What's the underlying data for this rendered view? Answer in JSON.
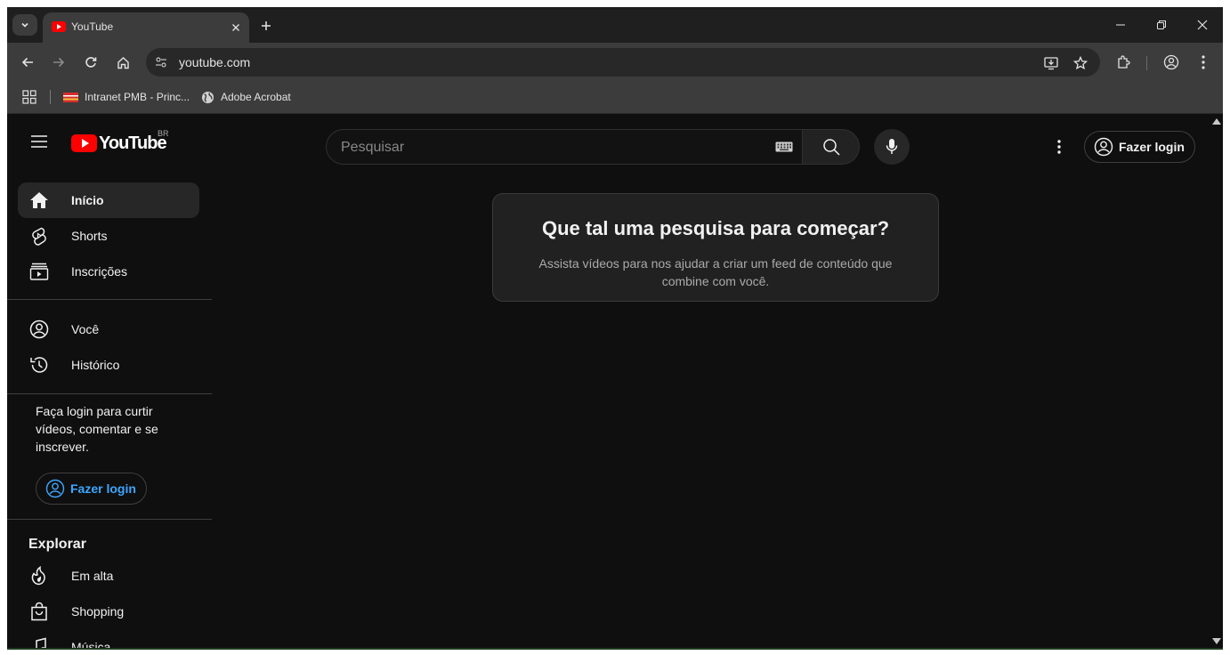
{
  "browser": {
    "tab_title": "YouTube",
    "url": "youtube.com",
    "bookmarks": [
      {
        "label": "Intranet PMB - Princ...",
        "icon": "flag-favicon"
      },
      {
        "label": "Adobe Acrobat",
        "icon": "globe-icon"
      }
    ]
  },
  "youtube": {
    "logo_text": "YouTube",
    "country_code": "BR",
    "search_placeholder": "Pesquisar",
    "login_label": "Fazer login",
    "sidebar": {
      "primary": [
        {
          "label": "Início",
          "icon": "home-icon",
          "active": true
        },
        {
          "label": "Shorts",
          "icon": "shorts-icon",
          "active": false
        },
        {
          "label": "Inscrições",
          "icon": "subscriptions-icon",
          "active": false
        }
      ],
      "you": [
        {
          "label": "Você",
          "icon": "user-icon"
        },
        {
          "label": "Histórico",
          "icon": "history-icon"
        }
      ],
      "login_message": "Faça login para curtir vídeos, comentar e se inscrever.",
      "login_label": "Fazer login",
      "explore_heading": "Explorar",
      "explore": [
        {
          "label": "Em alta",
          "icon": "trending-icon"
        },
        {
          "label": "Shopping",
          "icon": "shopping-bag-icon"
        },
        {
          "label": "Música",
          "icon": "music-icon"
        }
      ]
    },
    "empty_state": {
      "title": "Que tal uma pesquisa para começar?",
      "subtitle": "Assista vídeos para nos ajudar a criar um feed de conteúdo que combine com você."
    }
  },
  "colors": {
    "accent_red": "#ff0000",
    "link_blue": "#3ea6ff",
    "background": "#0f0f0f"
  }
}
